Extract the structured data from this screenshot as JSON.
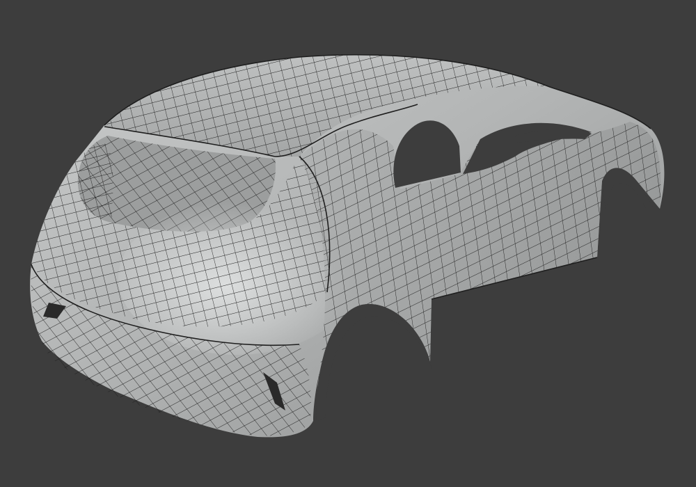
{
  "viewport": {
    "background": "#3d3d3d",
    "object": "car-body-mesh",
    "shading": "solid",
    "overlay": "wireframe",
    "surface_color": "#b5b7b7",
    "wire_color": "#1e1e1e"
  }
}
